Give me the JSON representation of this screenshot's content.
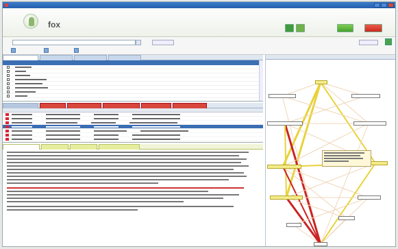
{
  "header": {
    "brand": "fox",
    "subtitle": ""
  },
  "colors": {
    "accent": "#3b6fb4",
    "warning": "#d23333",
    "edge_strong": "#cc2222",
    "edge_medium": "#e8d23a",
    "edge_light": "#f0c8a0",
    "node_highlight": "#f3ec8a"
  },
  "icons": [
    "app-icon",
    "checkbox-icon",
    "warning-icon",
    "combo-dropdown-icon",
    "go-green-icon"
  ],
  "graph": {
    "panel_title": ""
  }
}
